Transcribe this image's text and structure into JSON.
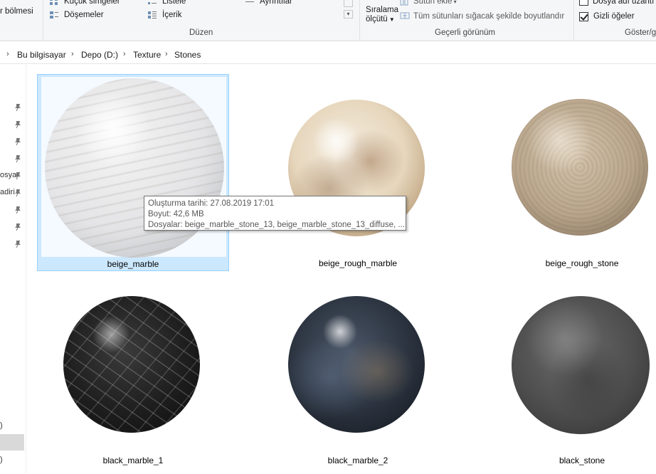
{
  "ribbon": {
    "nav_pane_label": "r bölmesi",
    "layout": {
      "small_icons": "Küçük simgeler",
      "list": "Listele",
      "details": "Ayrıntılar",
      "tiles": "Döşemeler",
      "content": "İçerik",
      "group_label": "Düzen"
    },
    "current_view": {
      "sort_by_line1": "Sıralama",
      "sort_by_line2": "ölçütü",
      "add_columns": "Sütun ekle",
      "fit_columns": "Tüm sütunları sığacak şekilde boyutlandır",
      "group_label": "Geçerli görünüm"
    },
    "show_hide": {
      "file_extensions": "Dosya adı uzantı",
      "hidden_items": "Gizli öğeler",
      "hidden_items_checked": true,
      "file_extensions_checked": false,
      "group_label": "Göster/gi"
    }
  },
  "breadcrumb": {
    "items": [
      "Bu bilgisayar",
      "Depo (D:)",
      "Texture",
      "Stones"
    ]
  },
  "nav_pane": {
    "fragments": [
      "osya",
      "adiri",
      ")",
      ")"
    ]
  },
  "files": [
    {
      "name": "beige_marble",
      "selected": true
    },
    {
      "name": "beige_rough_marble",
      "selected": false
    },
    {
      "name": "beige_rough_stone",
      "selected": false
    },
    {
      "name": "black_marble_1",
      "selected": false
    },
    {
      "name": "black_marble_2",
      "selected": false
    },
    {
      "name": "black_stone",
      "selected": false
    }
  ],
  "tooltip": {
    "created": "Oluşturma tarihi: 27.08.2019 17:01",
    "size": "Boyut: 42,6 MB",
    "files": "Dosyalar: beige_marble_stone_13, beige_marble_stone_13_diffuse, ..."
  }
}
